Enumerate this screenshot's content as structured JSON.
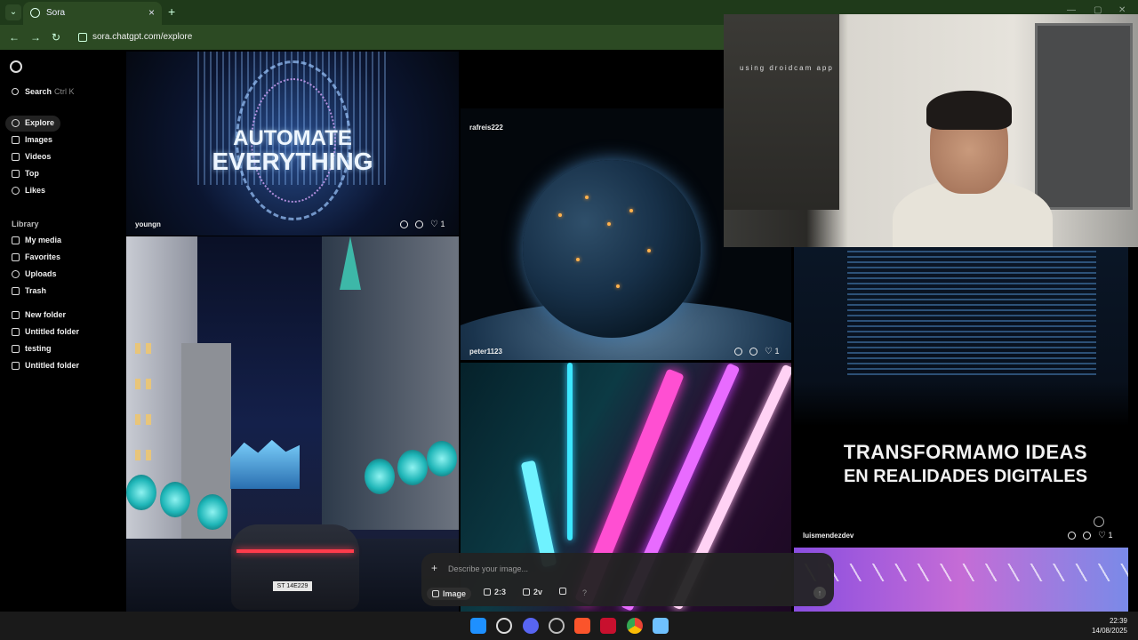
{
  "browser": {
    "tab_title": "Sora",
    "url": "sora.chatgpt.com/explore",
    "new_tab": "+",
    "close_tab": "×"
  },
  "sidebar": {
    "search_label": "Search",
    "search_shortcut": "Ctrl K",
    "nav": [
      "Explore",
      "Images",
      "Videos",
      "Top",
      "Likes"
    ],
    "library_heading": "Library",
    "library": [
      "My media",
      "Favorites",
      "Uploads",
      "Trash"
    ],
    "folders": [
      "New folder",
      "Untitled folder",
      "testing",
      "Untitled folder"
    ]
  },
  "tiles": {
    "automate": {
      "line1": "AUTOMATE",
      "line2": "EVERYTHING",
      "user": "youngn",
      "likes": "1"
    },
    "earth": {
      "user": "peter1123",
      "likes": "1"
    },
    "top_user": "rafreis222",
    "transform": {
      "line1": "TRANSFORMAMO IDEAS",
      "line2": "EN REALIDADES DIGITALES",
      "user": "luismendezdev",
      "likes": "1"
    },
    "car_plate": "ST 14E229"
  },
  "webcam": {
    "caption": "using droidcam app"
  },
  "prompt": {
    "placeholder": "Describe your image...",
    "type_label": "Image",
    "ratio_label": "2:3",
    "variations_label": "2v",
    "help": "?"
  },
  "taskbar": {
    "time": "22:39",
    "date": "14/08/2025"
  }
}
